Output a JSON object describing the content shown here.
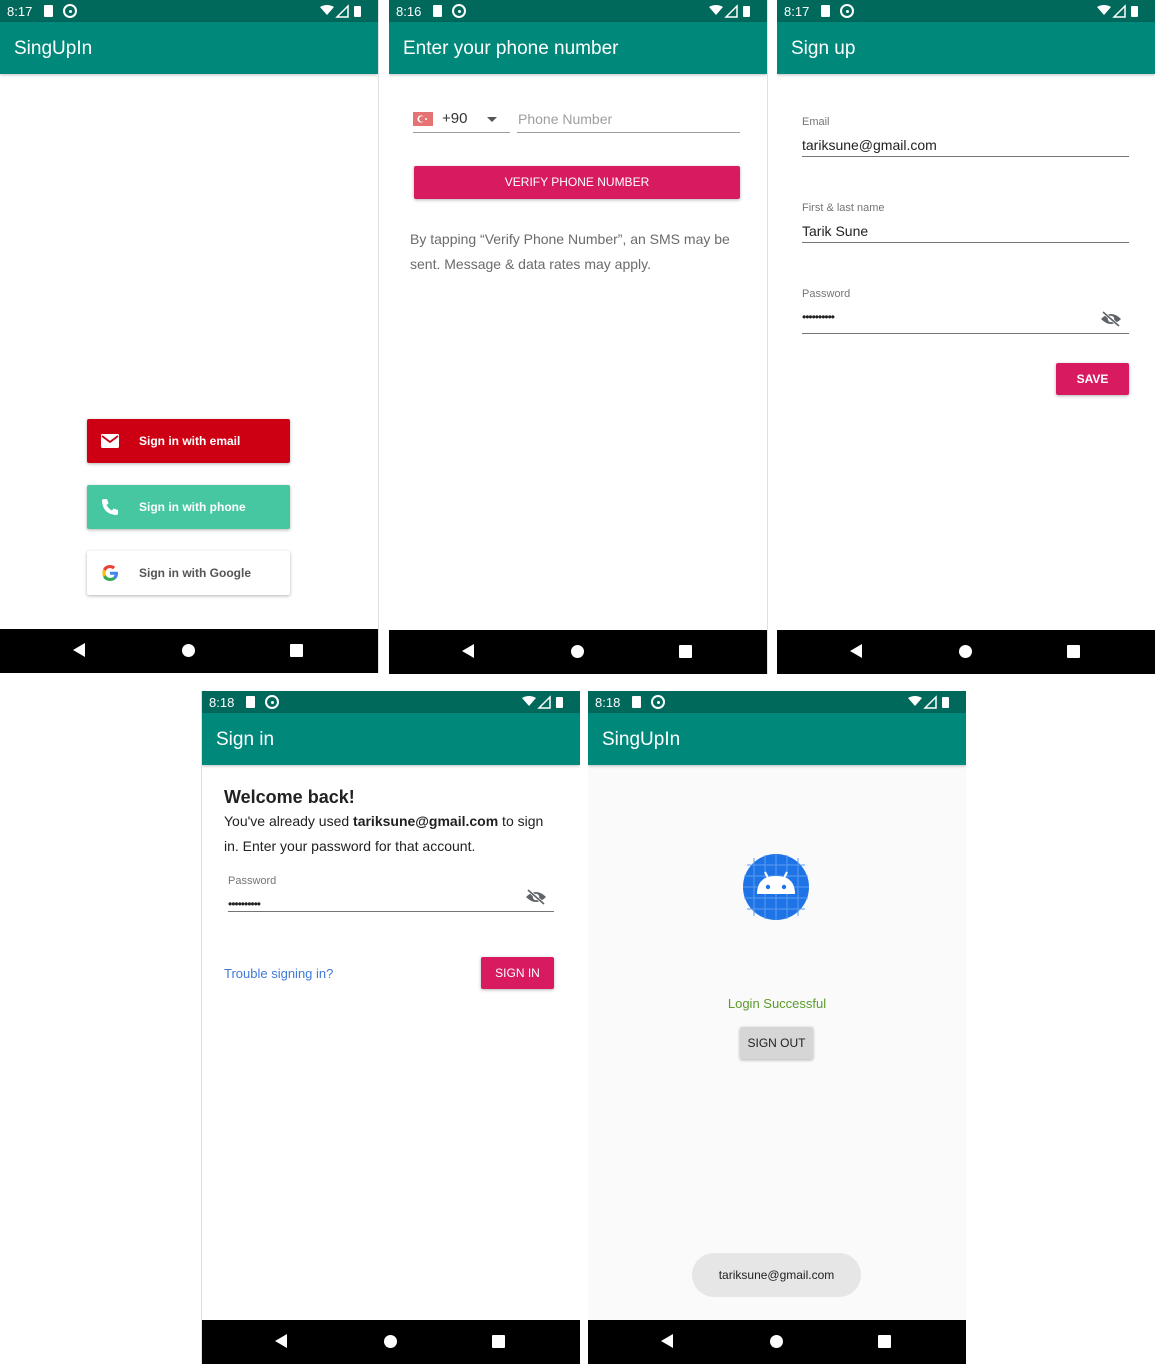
{
  "screens": {
    "s1": {
      "time": "8:17",
      "title": "SingUpIn",
      "buttons": {
        "email": "Sign in with email",
        "phone": "Sign in with phone",
        "google": "Sign in with Google"
      }
    },
    "s2": {
      "time": "8:16",
      "title": "Enter your phone number",
      "country_code": "+90",
      "phone_placeholder": "Phone Number",
      "verify_label": "VERIFY PHONE NUMBER",
      "disclaimer_line1": "By tapping “Verify Phone Number”, an SMS may be",
      "disclaimer_line2": "sent. Message & data rates may apply."
    },
    "s3": {
      "time": "8:17",
      "title": "Sign up",
      "email_label": "Email",
      "email_value": "tariksune@gmail.com",
      "name_label": "First & last name",
      "name_value": "Tarik Sune",
      "password_label": "Password",
      "password_value": "••••••••••",
      "save_label": "SAVE"
    },
    "s4": {
      "time": "8:18",
      "title": "Sign in",
      "heading": "Welcome back!",
      "body_prefix": "You've already used ",
      "body_email": "tariksune@gmail.com",
      "body_suffix": " to sign",
      "body_line2": "in. Enter your password for that account.",
      "password_label": "Password",
      "password_value": "••••••••••",
      "trouble_link": "Trouble signing in?",
      "signin_label": "SIGN IN"
    },
    "s5": {
      "time": "8:18",
      "title": "SingUpIn",
      "status": "Login Successful",
      "signout_label": "SIGN OUT",
      "toast": "tariksune@gmail.com"
    }
  },
  "colors": {
    "statusbar": "#00695c",
    "appbar": "#00897b",
    "accent": "#d81b60",
    "email_btn": "#cc0012",
    "phone_btn": "#46c7a1",
    "success_text": "#5c9c2a",
    "link": "#3f7ad9"
  }
}
